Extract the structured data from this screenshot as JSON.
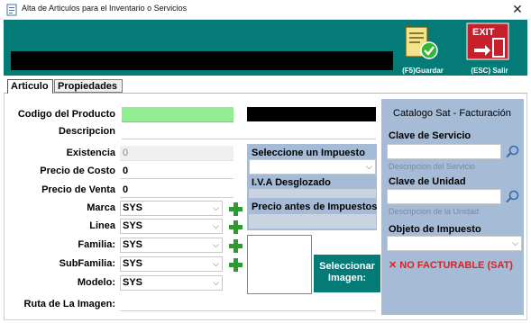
{
  "window": {
    "title": "Alta de Articulos para el Inventario o Servicios",
    "close_glyph": "✕"
  },
  "toolbar": {
    "save_label": "(F5)Guardar",
    "exit_label": "(ESC) Salir",
    "exit_sign": "EXIT"
  },
  "tabs": [
    {
      "label": "Articulo"
    },
    {
      "label": "Propiedades"
    }
  ],
  "form": {
    "codigo_label": "Codigo del Producto",
    "descripcion_label": "Descripcion",
    "existencia_label": "Existencia",
    "existencia_value": "0",
    "precio_costo_label": "Precio de Costo",
    "precio_costo_value": "0",
    "precio_venta_label": "Precio de Venta",
    "precio_venta_value": "0",
    "marca_label": "Marca",
    "marca_value": "SYS",
    "linea_label": "Linea",
    "linea_value": "SYS",
    "familia_label": "Familia:",
    "familia_value": "SYS",
    "subfamilia_label": "SubFamilia:",
    "subfamilia_value": "SYS",
    "modelo_label": "Modelo:",
    "modelo_value": "SYS",
    "ruta_label": "Ruta de La Imagen:"
  },
  "impuestos": {
    "select_label": "Seleccione un Impuesto",
    "iva_label": "I.V.A Desglozado",
    "precio_antes_label": "Precio antes de Impuestos"
  },
  "imagen": {
    "button_label": "Seleccionar Imagen:"
  },
  "sat": {
    "title": "Catalogo Sat - Facturación",
    "clave_servicio_label": "Clave de Servicio",
    "desc_servicio": "Descripcion del Servicio",
    "clave_unidad_label": "Clave de Unidad",
    "desc_unidad": "Descripcion de la Unidad",
    "objeto_label": "Objeto de Impuesto",
    "no_facturable": "NO FACTURABLE (SAT)",
    "no_facturable_icon": "✕"
  },
  "colors": {
    "header": "#057b77",
    "sat_panel": "#a6bbd6",
    "codigo_field": "#90ee90",
    "no_facturable": "#e02020",
    "plus": "#2f9a2f"
  }
}
